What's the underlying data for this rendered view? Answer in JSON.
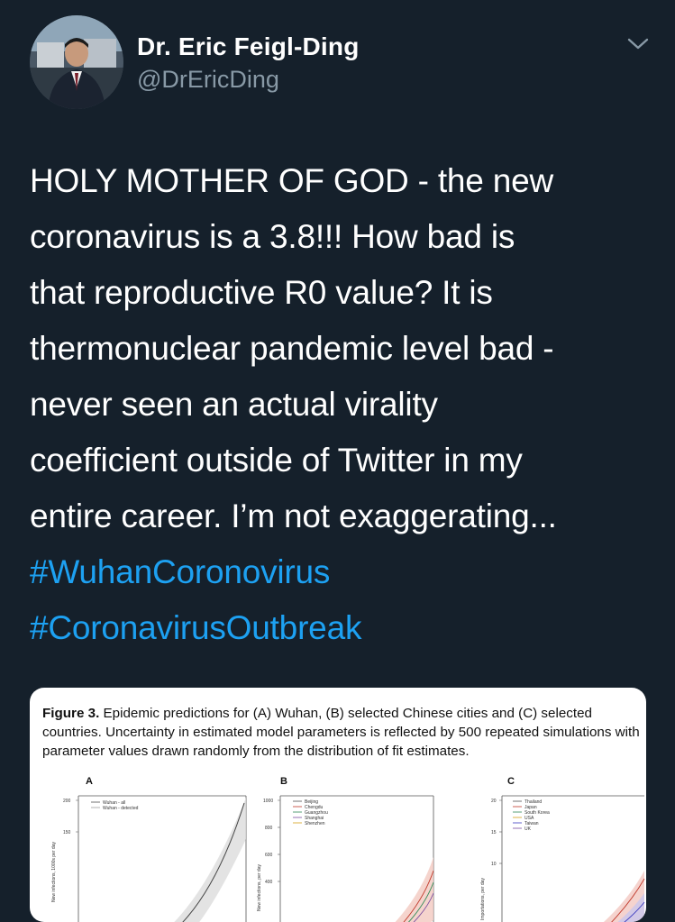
{
  "author": {
    "name": "Dr. Eric Feigl-Ding",
    "handle": "@DrEricDing"
  },
  "tweet": {
    "text": "HOLY MOTHER OF GOD - the new\ncoronavirus is a 3.8!!! How bad is\nthat reproductive R0 value? It is\nthermonuclear pandemic level bad -\nnever seen an actual virality\ncoefficient outside of Twitter in my\nentire career. I’m not exaggerating...",
    "hashtags": [
      "#WuhanCoronovirus",
      "#CoronavirusOutbreak"
    ]
  },
  "media": {
    "figure_label": "Figure 3.",
    "figure_caption": " Epidemic predictions for (A) Wuhan, (B) selected Chinese cities and (C) selected countries. Uncertainty in estimated model parameters is reflected by 500 repeated simulations with parameter values drawn randomly from the distribution of fit estimates.",
    "panels": [
      {
        "letter": "A",
        "y_ticks": [
          "200",
          "150"
        ],
        "y_label": "New infections, 1000s per day",
        "legend": [
          "Wuhan - all",
          "Wuhan - detected"
        ]
      },
      {
        "letter": "B",
        "y_ticks": [
          "1000",
          "800",
          "600",
          "400"
        ],
        "y_label": "New infections, per day",
        "legend": [
          "Beijing",
          "Chengdu",
          "Guangzhou",
          "Shanghai",
          "Shenzhen"
        ]
      },
      {
        "letter": "C",
        "y_ticks": [
          "20",
          "15",
          "10"
        ],
        "y_label": "Importations, per day",
        "legend": [
          "Thailand",
          "Japan",
          "South Korea",
          "USA",
          "Taiwan",
          "UK"
        ]
      }
    ],
    "colors": {
      "accent": "#1da1f2",
      "background": "#15202b",
      "muted": "#8899a6"
    }
  }
}
